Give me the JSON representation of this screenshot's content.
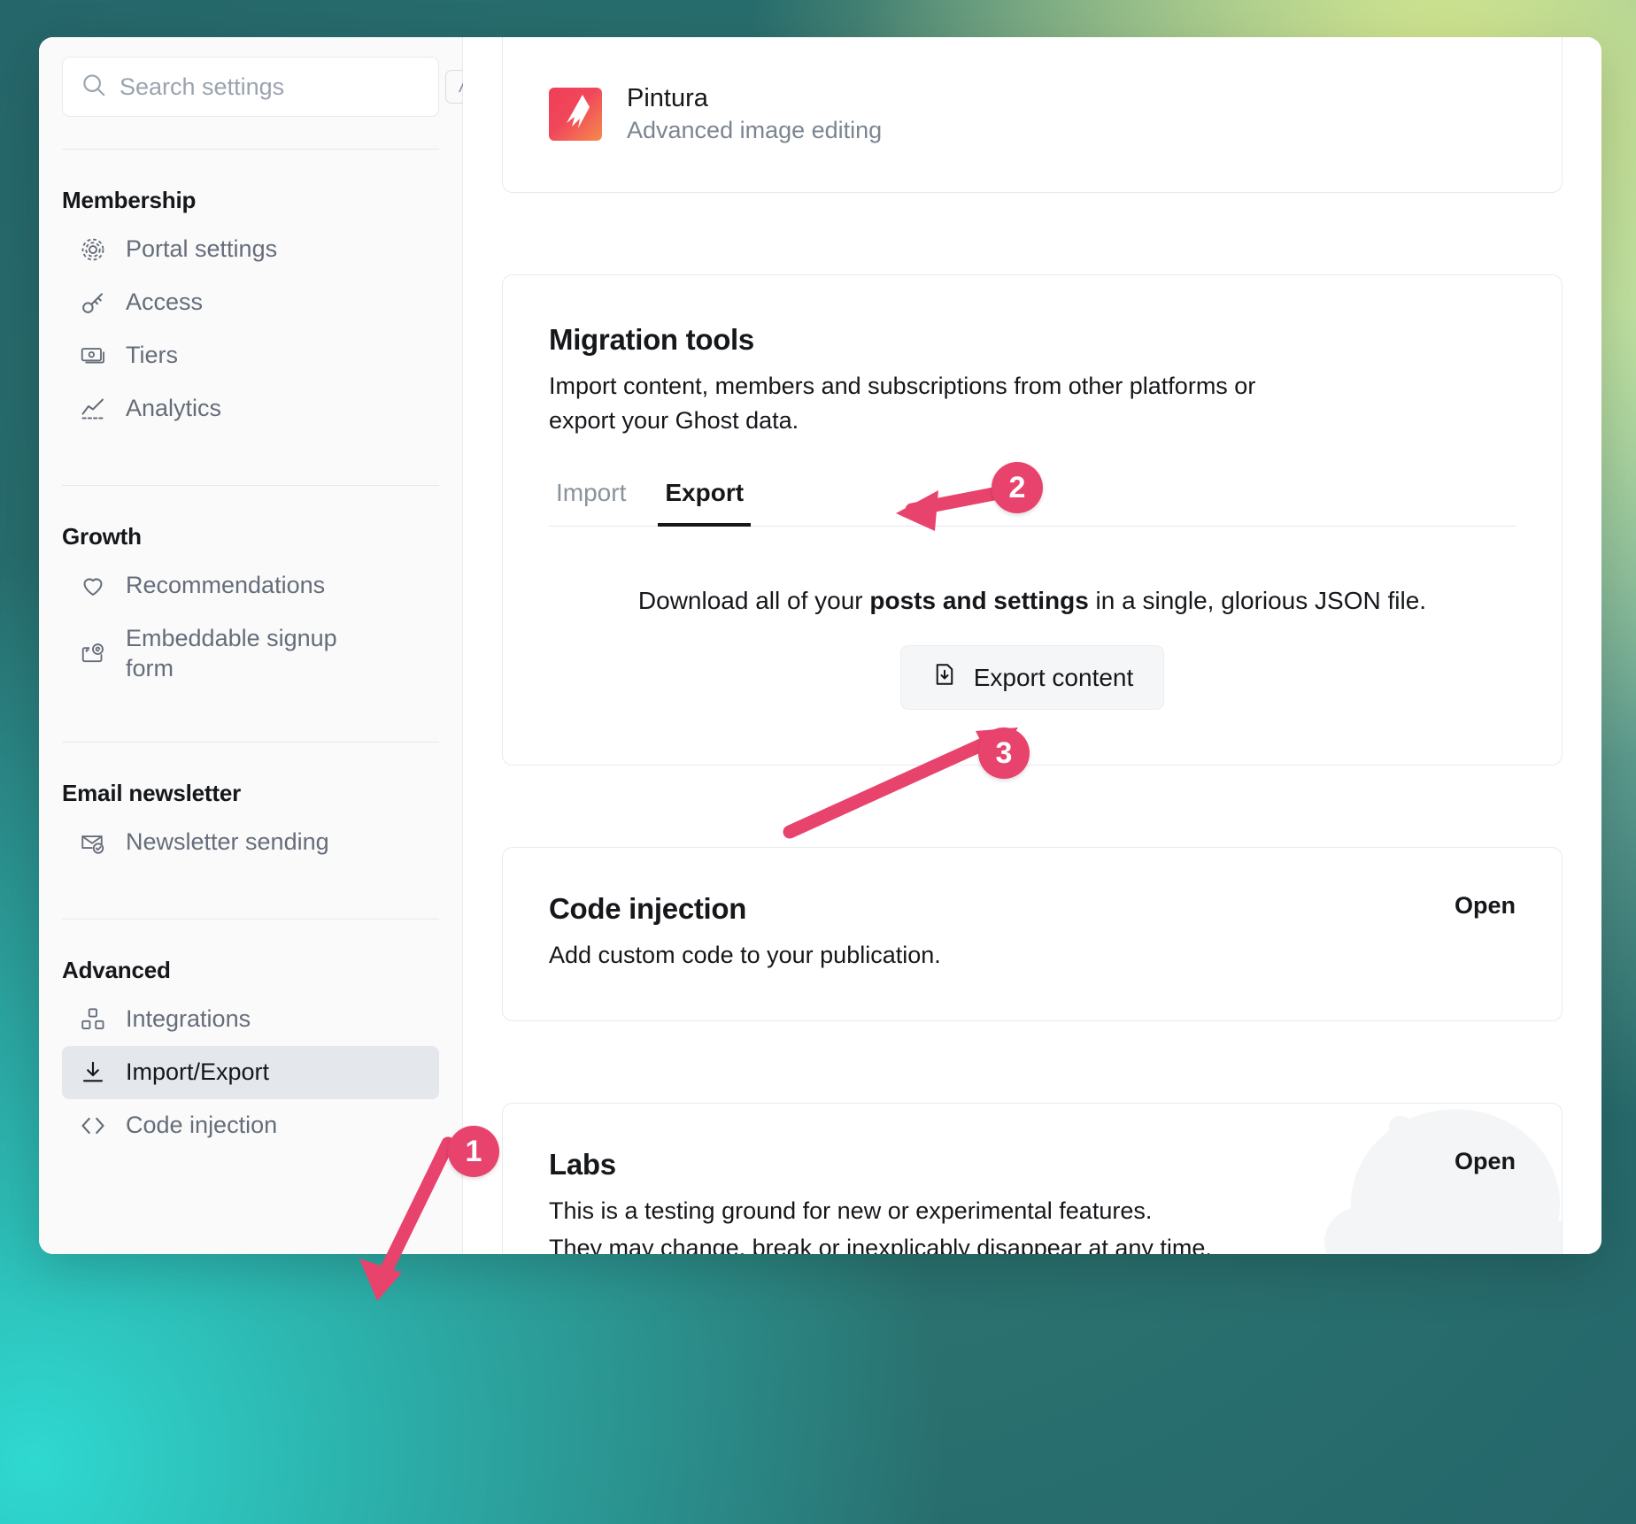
{
  "search": {
    "placeholder": "Search settings",
    "value": "",
    "shortcut": "/"
  },
  "sidebar": {
    "groups": [
      {
        "title": "Membership",
        "items": [
          {
            "label": "Portal settings",
            "icon": "portal-icon",
            "active": false
          },
          {
            "label": "Access",
            "icon": "key-icon",
            "active": false
          },
          {
            "label": "Tiers",
            "icon": "banknote-icon",
            "active": false
          },
          {
            "label": "Analytics",
            "icon": "chart-line-icon",
            "active": false
          }
        ]
      },
      {
        "title": "Growth",
        "items": [
          {
            "label": "Recommendations",
            "icon": "heart-icon",
            "active": false
          },
          {
            "label": "Embeddable signup form",
            "icon": "embed-signup-icon",
            "active": false
          }
        ]
      },
      {
        "title": "Email newsletter",
        "items": [
          {
            "label": "Newsletter sending",
            "icon": "mail-check-icon",
            "active": false
          }
        ]
      },
      {
        "title": "Advanced",
        "items": [
          {
            "label": "Integrations",
            "icon": "blocks-icon",
            "active": false
          },
          {
            "label": "Import/Export",
            "icon": "download-icon",
            "active": true
          },
          {
            "label": "Code injection",
            "icon": "code-brackets-icon",
            "active": false
          }
        ]
      }
    ]
  },
  "main": {
    "pintura": {
      "title": "Pintura",
      "subtitle": "Advanced image editing"
    },
    "migration": {
      "title": "Migration tools",
      "description": "Import content, members and subscriptions from other platforms or export your Ghost data.",
      "tabs": [
        {
          "label": "Import",
          "active": false
        },
        {
          "label": "Export",
          "active": true
        }
      ],
      "export_note_prefix": "Download all of your ",
      "export_note_bold": "posts and settings",
      "export_note_suffix": " in a single, glorious JSON file.",
      "export_button": "Export content"
    },
    "code_injection": {
      "title": "Code injection",
      "description": "Add custom code to your publication.",
      "open_label": "Open"
    },
    "labs": {
      "title": "Labs",
      "description_line1": "This is a testing ground for new or experimental features.",
      "description_line2": "They may change, break or inexplicably disappear at any time.",
      "open_label": "Open"
    }
  },
  "annotations": {
    "accent_color": "#e8436c",
    "steps": [
      {
        "number": "1",
        "target": "sidebar-item-import-export"
      },
      {
        "number": "2",
        "target": "tab-export"
      },
      {
        "number": "3",
        "target": "export-content-button"
      }
    ]
  }
}
